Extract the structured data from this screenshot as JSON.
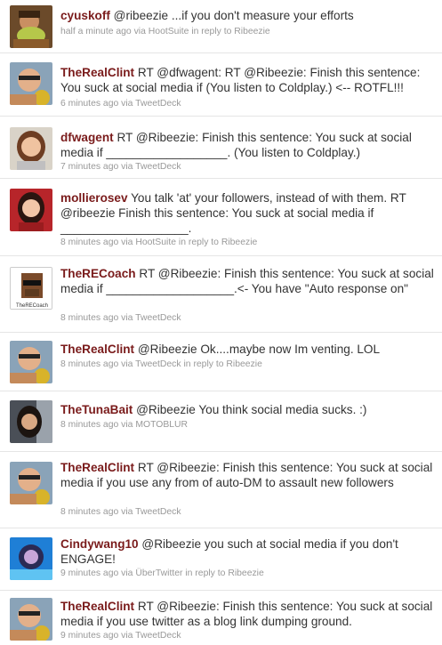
{
  "tweets": [
    {
      "user": "cyuskoff",
      "text": " @ribeezie ...if you don't measure your efforts",
      "time": "half a minute ago",
      "via": "via",
      "source": "HootSuite",
      "reply": "in reply to",
      "reply_to": "Ribeezie",
      "avatar": "food-avatar"
    },
    {
      "user": "TheRealClint",
      "text": " RT @dfwagent: RT @Ribeezie: Finish this sentence: You suck at social media if (You listen to Coldplay.) <-- ROTFL!!!",
      "time": "6 minutes ago",
      "via": "via",
      "source": "TweetDeck",
      "reply": "",
      "reply_to": "",
      "avatar": "clint-avatar"
    },
    {
      "user": "dfwagent",
      "text": " RT @Ribeezie: Finish this sentence: You suck at social media if __________________. (You listen to Coldplay.)",
      "time": "7 minutes ago",
      "via": "via",
      "source": "TweetDeck",
      "reply": "",
      "reply_to": "",
      "avatar": "woman-avatar"
    },
    {
      "user": "mollierosev",
      "text": " You talk 'at' your followers, instead of with them. RT @ribeezie Finish this sentence: You suck at social media if ___________________.",
      "time": "8 minutes ago",
      "via": "via",
      "source": "HootSuite",
      "reply": "in reply to",
      "reply_to": "Ribeezie",
      "avatar": "red-woman-avatar"
    },
    {
      "user": "TheRECoach",
      "text": " RT @Ribeezie: Finish this sentence: You suck at social media if ___________________.<- You have \"Auto response on\"",
      "time": "8 minutes ago",
      "via": "via",
      "source": "TweetDeck",
      "reply": "",
      "reply_to": "",
      "avatar": "coach-avatar",
      "avatar_label": "TheRECoach"
    },
    {
      "user": "TheRealClint",
      "text": " @Ribeezie Ok....maybe now Im venting. LOL",
      "time": "8 minutes ago",
      "via": "via",
      "source": "TweetDeck",
      "reply": "in reply to",
      "reply_to": "Ribeezie",
      "avatar": "clint-avatar"
    },
    {
      "user": "TheTunaBait",
      "text": " @Ribeezie You think social media sucks. :)",
      "time": "8 minutes ago",
      "via": "via",
      "source": "MOTOBLUR",
      "reply": "",
      "reply_to": "",
      "avatar": "car-woman-avatar"
    },
    {
      "user": "TheRealClint",
      "text": " RT @Ribeezie: Finish this sentence: You suck at social media if you use any from of auto-DM to assault new followers",
      "time": "8 minutes ago",
      "via": "via",
      "source": "TweetDeck",
      "reply": "",
      "reply_to": "",
      "avatar": "clint-avatar"
    },
    {
      "user": "Cindywang10",
      "text": " @Ribeezie you such at social media if you don't ENGAGE!",
      "time": "9 minutes ago",
      "via": "via",
      "source": "ÜberTwitter",
      "reply": "in reply to",
      "reply_to": "Ribeezie",
      "avatar": "blue-avatar"
    },
    {
      "user": "TheRealClint",
      "text": " RT @Ribeezie: Finish this sentence: You suck at social media if you use twitter as a blog link dumping ground.",
      "time": "9 minutes ago",
      "via": "via",
      "source": "TweetDeck",
      "reply": "",
      "reply_to": "",
      "avatar": "clint-avatar"
    }
  ]
}
